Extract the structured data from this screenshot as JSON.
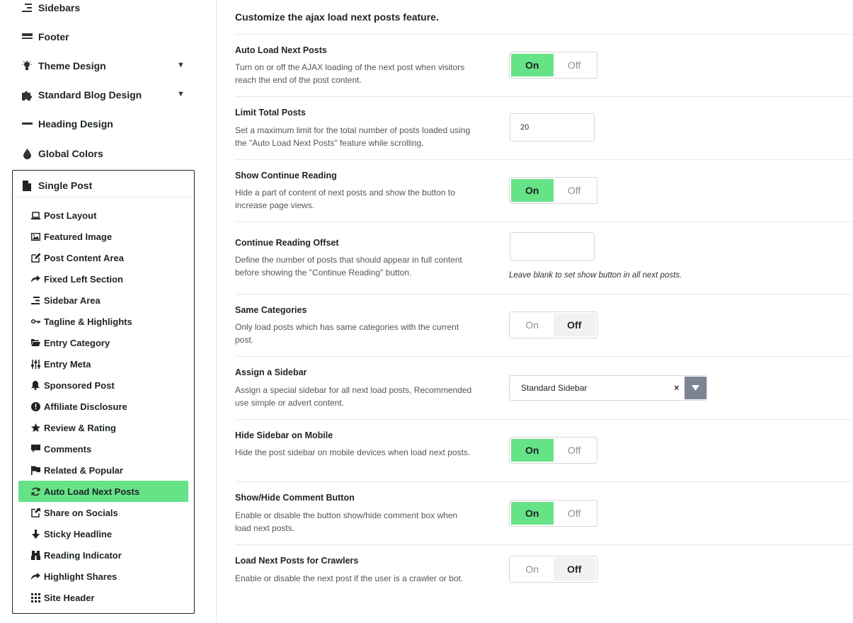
{
  "sidebar": {
    "top_items": [
      {
        "label": "Sidebars",
        "icon": "align-right-icon",
        "arrow": false
      },
      {
        "label": "Footer",
        "icon": "footer-icon",
        "arrow": false
      },
      {
        "label": "Theme Design",
        "icon": "lightbulb-icon",
        "arrow": true
      },
      {
        "label": "Standard Blog Design",
        "icon": "puzzle-icon",
        "arrow": true
      },
      {
        "label": "Heading Design",
        "icon": "minus-icon",
        "arrow": false
      },
      {
        "label": "Global Colors",
        "icon": "drop-icon",
        "arrow": false
      }
    ],
    "active_section": {
      "label": "Single Post",
      "icon": "document-icon",
      "items": [
        {
          "label": "Post Layout",
          "icon": "laptop-icon"
        },
        {
          "label": "Featured Image",
          "icon": "image-icon"
        },
        {
          "label": "Post Content Area",
          "icon": "edit-icon"
        },
        {
          "label": "Fixed Left Section",
          "icon": "share-arrow-icon"
        },
        {
          "label": "Sidebar Area",
          "icon": "align-right-icon"
        },
        {
          "label": "Tagline & Highlights",
          "icon": "key-icon"
        },
        {
          "label": "Entry Category",
          "icon": "folder-open-icon"
        },
        {
          "label": "Entry Meta",
          "icon": "sliders-icon"
        },
        {
          "label": "Sponsored Post",
          "icon": "bell-icon"
        },
        {
          "label": "Affiliate Disclosure",
          "icon": "exclamation-circle-icon"
        },
        {
          "label": "Review & Rating",
          "icon": "star-icon"
        },
        {
          "label": "Comments",
          "icon": "comment-icon"
        },
        {
          "label": "Related & Popular",
          "icon": "flag-icon"
        },
        {
          "label": "Auto Load Next Posts",
          "icon": "refresh-icon",
          "active": true
        },
        {
          "label": "Share on Socials",
          "icon": "external-share-icon"
        },
        {
          "label": "Sticky Headline",
          "icon": "arrow-down-icon"
        },
        {
          "label": "Reading Indicator",
          "icon": "binoculars-icon"
        },
        {
          "label": "Highlight Shares",
          "icon": "share-arrow-icon"
        },
        {
          "label": "Site Header",
          "icon": "grid-icon"
        }
      ]
    }
  },
  "main": {
    "intro": "Customize the ajax load next posts feature.",
    "options": [
      {
        "title": "Auto Load Next Posts",
        "desc": "Turn on or off the AJAX loading of the next post when visitors reach the end of the post content.",
        "control": "toggle",
        "value": "On"
      },
      {
        "title": "Limit Total Posts",
        "desc": "Set a maximum limit for the total number of posts loaded using the \"Auto Load Next Posts\" feature while scrolling.",
        "control": "text",
        "value": "20"
      },
      {
        "title": "Show Continue Reading",
        "desc": "Hide a part of content of next posts and show the button to increase page views.",
        "control": "toggle",
        "value": "On"
      },
      {
        "title": "Continue Reading Offset",
        "desc": "Define the number of posts that should appear in full content before showing the \"Continue Reading\" button.",
        "control": "text",
        "value": "",
        "hint": "Leave blank to set show button in all next posts."
      },
      {
        "title": "Same Categories",
        "desc": "Only load posts which has same categories with the current post.",
        "control": "toggle",
        "value": "Off"
      },
      {
        "title": "Assign a Sidebar",
        "desc": "Assign a special sidebar for all next load posts, Recommended use simple or advert content.",
        "control": "select",
        "value": "Standard Sidebar",
        "clear": "×"
      },
      {
        "title": "Hide Sidebar on Mobile",
        "desc": "Hide the post sidebar on mobile devices when load next posts.",
        "control": "toggle",
        "value": "On"
      },
      {
        "title": "Show/Hide Comment Button",
        "desc": "Enable or disable the button show/hide comment box when load next posts.",
        "control": "toggle",
        "value": "On"
      },
      {
        "title": "Load Next Posts for Crawlers",
        "desc": "Enable or disable the next post if the user is a crawler or bot.",
        "control": "toggle",
        "value": "Off"
      }
    ],
    "toggle_labels": {
      "on": "On",
      "off": "Off"
    }
  },
  "colors": {
    "accent": "#66e287",
    "select_arrow_bg": "#7c8492"
  }
}
